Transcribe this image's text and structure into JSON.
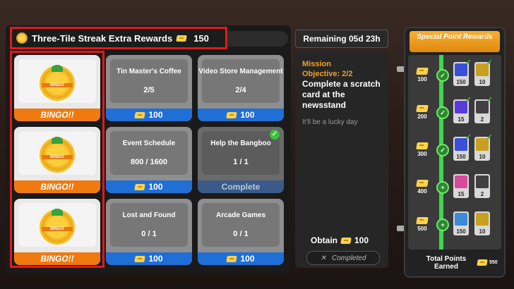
{
  "header": {
    "title": "Three-Tile Streak Extra Rewards",
    "points": "150"
  },
  "remaining": "Remaining 05d 23h",
  "cards": [
    {
      "type": "bingo",
      "label": "BINGO!!",
      "badge": "BINGO"
    },
    {
      "type": "task",
      "name": "Tin Master's Coffee",
      "progress": "2/5",
      "reward": "100"
    },
    {
      "type": "task",
      "name": "Video Store Management",
      "progress": "2/4",
      "reward": "100"
    },
    {
      "type": "bingo",
      "label": "BINGO!!",
      "badge": "BINGO"
    },
    {
      "type": "task",
      "name": "Event Schedule",
      "progress": "800 / 1600",
      "reward": "100"
    },
    {
      "type": "done",
      "name": "Help the Bangboo",
      "progress": "1 / 1",
      "reward": "Complete"
    },
    {
      "type": "bingo",
      "label": "BINGO!!",
      "badge": "BINGO"
    },
    {
      "type": "task",
      "name": "Lost and Found",
      "progress": "0 / 1",
      "reward": "100"
    },
    {
      "type": "task",
      "name": "Arcade Games",
      "progress": "0 / 1",
      "reward": "100"
    }
  ],
  "mission": {
    "heading": "Mission Objective: 2/2",
    "text": "Complete a scratch card at the newsstand",
    "flavor": "It'll be a lucky day",
    "obtain_label": "Obtain",
    "obtain_value": "100",
    "status": "Completed"
  },
  "special": {
    "title": "Special Point Rewards",
    "rows": [
      {
        "threshold": "100",
        "items": [
          {
            "qty": "150",
            "color": "#3a4fd8",
            "ok": true
          },
          {
            "qty": "10",
            "color": "#c8a020",
            "ok": true
          }
        ]
      },
      {
        "threshold": "200",
        "items": [
          {
            "qty": "15",
            "color": "#5a3ad8",
            "ok": true
          },
          {
            "qty": "2",
            "color": "#404040",
            "ok": true
          }
        ]
      },
      {
        "threshold": "300",
        "items": [
          {
            "qty": "150",
            "color": "#3a4fd8",
            "ok": true
          },
          {
            "qty": "10",
            "color": "#c8a020",
            "ok": true
          }
        ]
      },
      {
        "threshold": "400",
        "items": [
          {
            "qty": "15",
            "color": "#d84a9a",
            "ok": false
          },
          {
            "qty": "2",
            "color": "#404040",
            "ok": false
          }
        ]
      },
      {
        "threshold": "500",
        "items": [
          {
            "qty": "150",
            "color": "#3a8ad8",
            "ok": false
          },
          {
            "qty": "10",
            "color": "#c8a020",
            "ok": false
          }
        ]
      }
    ],
    "total_label": "Total Points Earned",
    "total_value": "550"
  }
}
